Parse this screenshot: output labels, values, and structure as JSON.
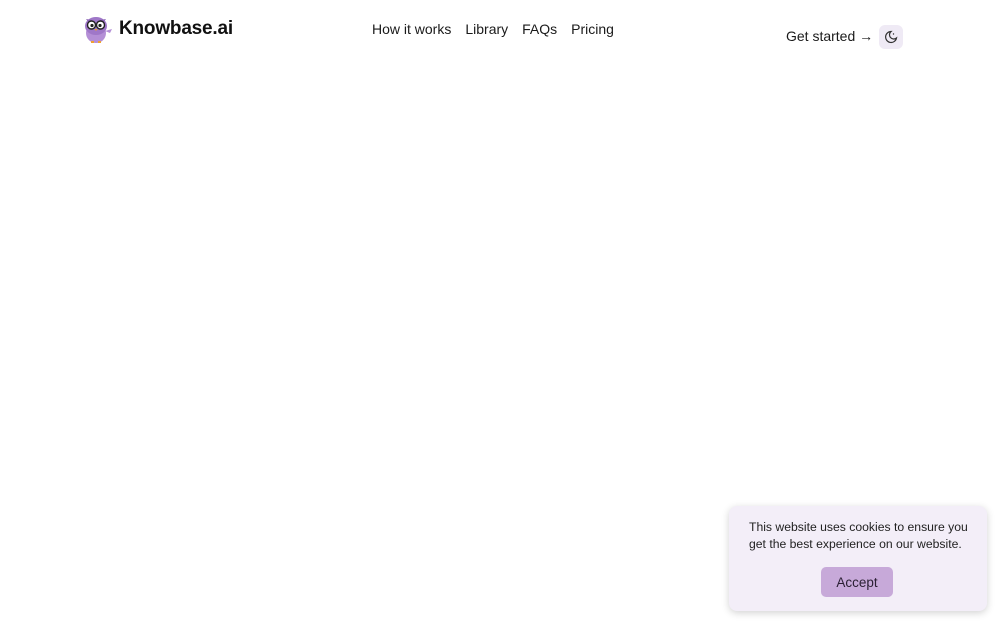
{
  "header": {
    "brand_name": "Knowbase.ai",
    "logo_icon": "owl-logo-icon",
    "nav": [
      {
        "label": "How it works"
      },
      {
        "label": "Library"
      },
      {
        "label": "FAQs"
      },
      {
        "label": "Pricing"
      }
    ],
    "cta_label": "Get started →",
    "theme_toggle_icon": "moon-icon"
  },
  "cookie_banner": {
    "message": "This website uses cookies to ensure you get the best experience on our website.",
    "accept_label": "Accept"
  },
  "colors": {
    "accent": "#c7a9d9",
    "banner_background": "#f3eef8",
    "toggle_background": "#efeaf5"
  }
}
